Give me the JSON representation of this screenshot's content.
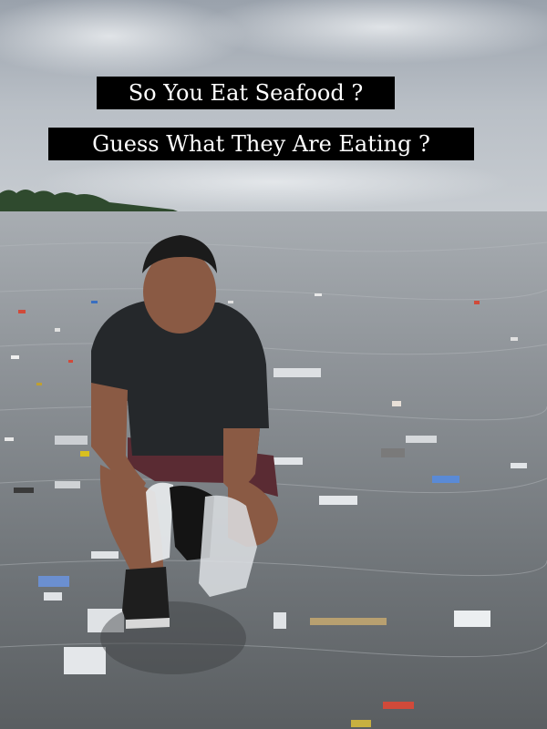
{
  "caption": {
    "line1": "So You Eat Seafood ?",
    "line2": "Guess What They Are Eating ?"
  }
}
